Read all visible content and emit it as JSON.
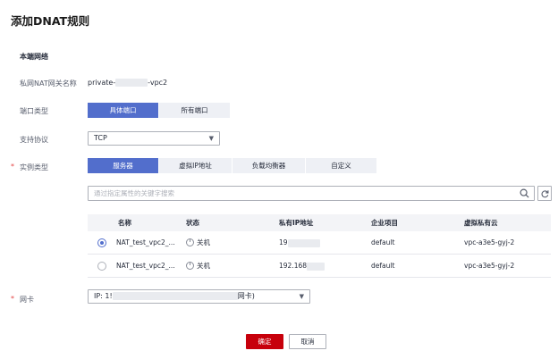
{
  "page": {
    "title": "添加DNAT规则",
    "section_title": "本端网络"
  },
  "nat_gateway": {
    "label": "私网NAT网关名称",
    "name_prefix": "private-",
    "name_suffix": "-vpc2"
  },
  "port_type": {
    "label": "端口类型",
    "options": [
      "具体端口",
      "所有端口"
    ],
    "selected": 0
  },
  "protocol": {
    "label": "支持协议",
    "value": "TCP"
  },
  "instance_type": {
    "label": "实例类型",
    "required_mark": "*",
    "options": [
      "服务器",
      "虚拟IP地址",
      "负载均衡器",
      "自定义"
    ],
    "selected": 0
  },
  "search": {
    "placeholder": "通过指定属性的关键字搜索"
  },
  "table": {
    "headers": [
      "名称",
      "状态",
      "私有IP地址",
      "企业项目",
      "虚拟私有云"
    ],
    "rows": [
      {
        "name": "NAT_test_vpc2_...",
        "status": "关机",
        "ip": "19",
        "enterprise": "default",
        "vpc": "vpc-a3e5-gyj-2",
        "selected": true
      },
      {
        "name": "NAT_test_vpc2_...",
        "status": "关机",
        "ip": "192.168",
        "enterprise": "default",
        "vpc": "vpc-a3e5-gyj-2",
        "selected": false
      }
    ]
  },
  "nic": {
    "label": "网卡",
    "required_mark": "*",
    "value_prefix": "IP: 1!",
    "value_suffix": "网卡)"
  },
  "buttons": {
    "confirm": "确定",
    "cancel": "取消"
  },
  "colors": {
    "accent": "#526ecc",
    "danger": "#c7000b",
    "required": "#e54545"
  }
}
